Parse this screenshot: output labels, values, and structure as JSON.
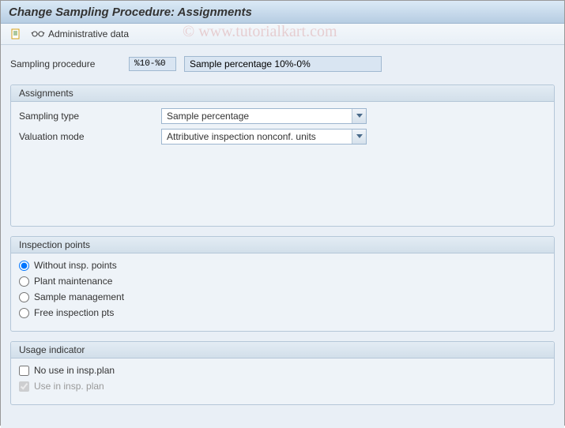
{
  "title": "Change Sampling Procedure: Assignments",
  "toolbar": {
    "admin_label": "Administrative data"
  },
  "sampling_procedure": {
    "label": "Sampling procedure",
    "code": "%10-%0",
    "description": "Sample percentage 10%-0%"
  },
  "assignments": {
    "group_title": "Assignments",
    "sampling_type_label": "Sampling type",
    "sampling_type_value": "Sample percentage",
    "valuation_mode_label": "Valuation mode",
    "valuation_mode_value": "Attributive inspection nonconf. units"
  },
  "inspection_points": {
    "group_title": "Inspection points",
    "options": {
      "without": "Without insp. points",
      "plant": "Plant maintenance",
      "sample": "Sample management",
      "free": "Free inspection pts"
    },
    "selected": "without"
  },
  "usage": {
    "group_title": "Usage indicator",
    "no_use_label": "No use in insp.plan",
    "use_label": "Use in insp. plan",
    "no_use_checked": false,
    "use_checked": true,
    "use_disabled": true
  },
  "watermark": "© www.tutorialkart.com"
}
